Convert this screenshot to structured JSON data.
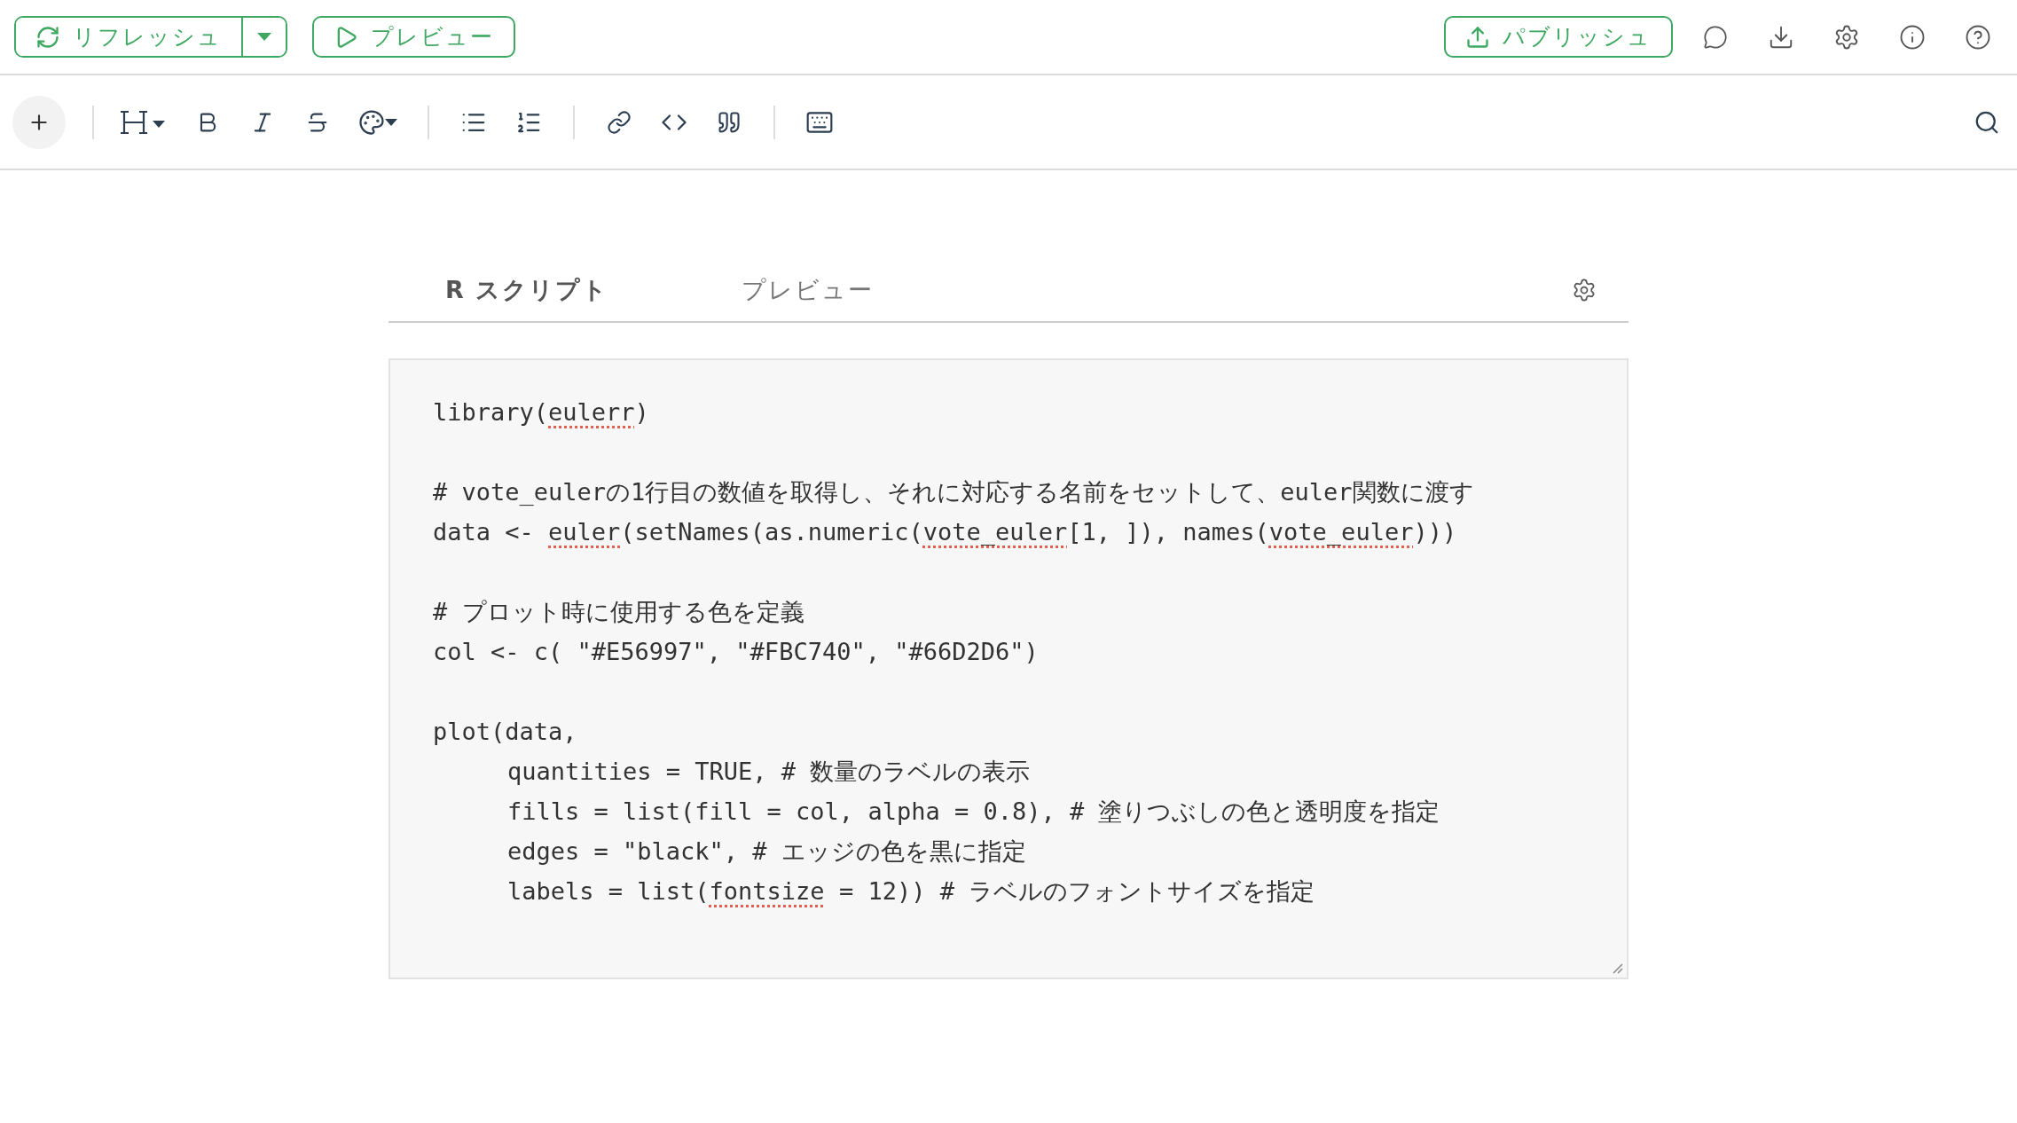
{
  "header": {
    "refresh_button": "リフレッシュ",
    "preview_button": "プレビュー",
    "publish_button": "パブリッシュ"
  },
  "tabs": [
    {
      "label": "R スクリプト",
      "selected": true
    },
    {
      "label": "プレビュー",
      "selected": false
    }
  ],
  "code": {
    "blocks": [
      {
        "lines": [
          {
            "segments": [
              {
                "text": "library(",
                "misspelled": false
              },
              {
                "text": "eulerr",
                "misspelled": true
              },
              {
                "text": ")",
                "misspelled": false
              }
            ]
          }
        ]
      },
      {
        "lines": [
          {
            "segments": [
              {
                "text": "# vote_eulerの1行目の数値を取得し、それに対応する名前をセットして、euler関数に渡す",
                "misspelled": false
              }
            ]
          },
          {
            "segments": [
              {
                "text": "data <- ",
                "misspelled": false
              },
              {
                "text": "euler",
                "misspelled": true
              },
              {
                "text": "(setNames(as.numeric(",
                "misspelled": false
              },
              {
                "text": "vote_euler",
                "misspelled": true
              },
              {
                "text": "[1, ]), names(",
                "misspelled": false
              },
              {
                "text": "vote_euler",
                "misspelled": true
              },
              {
                "text": ")))",
                "misspelled": false
              }
            ]
          }
        ]
      },
      {
        "lines": [
          {
            "segments": [
              {
                "text": "# プロット時に使用する色を定義",
                "misspelled": false
              }
            ]
          },
          {
            "segments": [
              {
                "text": "col <- c( \"#E56997\", \"#FBC740\", \"#66D2D6\")",
                "misspelled": false
              }
            ]
          }
        ]
      },
      {
        "lines": [
          {
            "segments": [
              {
                "text": "plot(data,",
                "misspelled": false
              }
            ],
            "children": [
              {
                "segments": [
                  {
                    "text": "quantities = TRUE, # 数量のラベルの表示",
                    "misspelled": false
                  }
                ]
              },
              {
                "segments": [
                  {
                    "text": "fills = list(fill = col, alpha = 0.8), # 塗りつぶしの色と透明度を指定",
                    "misspelled": false
                  }
                ]
              },
              {
                "segments": [
                  {
                    "text": "edges = \"black\", # エッジの色を黒に指定",
                    "misspelled": false
                  }
                ]
              },
              {
                "segments": [
                  {
                    "text": "labels = list(",
                    "misspelled": false
                  },
                  {
                    "text": "fontsize",
                    "misspelled": true
                  },
                  {
                    "text": " = 12)) # ラベルのフォントサイズを指定",
                    "misspelled": false
                  }
                ]
              }
            ]
          }
        ]
      }
    ]
  }
}
